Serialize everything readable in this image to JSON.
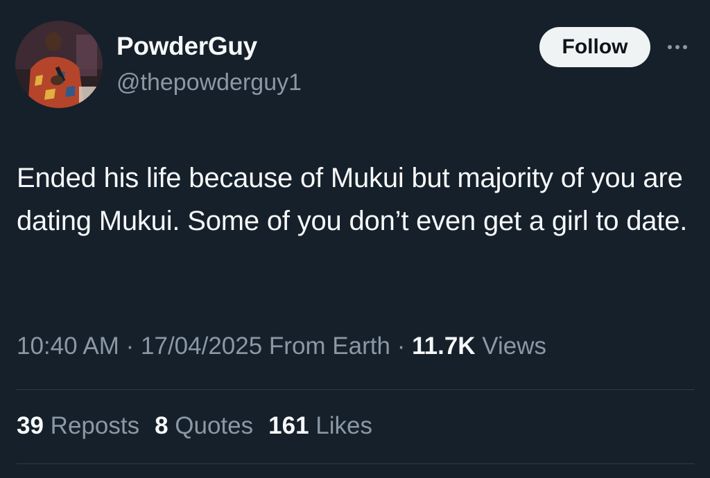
{
  "author": {
    "display_name": "PowderGuy",
    "handle": "@thepowderguy1"
  },
  "actions": {
    "follow_label": "Follow",
    "more_icon": "more-horizontal-icon"
  },
  "tweet": {
    "text": "Ended his life because of Mukui but majority of you are dating Mukui. Some of you don’t even get a girl to date."
  },
  "meta": {
    "time": "10:40 AM",
    "separator": "·",
    "date": "17/04/2025",
    "source": "From Earth",
    "views_count": "11.7K",
    "views_label": "Views"
  },
  "stats": {
    "reposts_count": "39",
    "reposts_label": "Reposts",
    "quotes_count": "8",
    "quotes_label": "Quotes",
    "likes_count": "161",
    "likes_label": "Likes"
  },
  "colors": {
    "background": "#15202b",
    "primary_text": "#f7f9f9",
    "secondary_text": "#8b98a5",
    "follow_button_bg": "#eff3f4",
    "divider": "#2f3b47"
  }
}
